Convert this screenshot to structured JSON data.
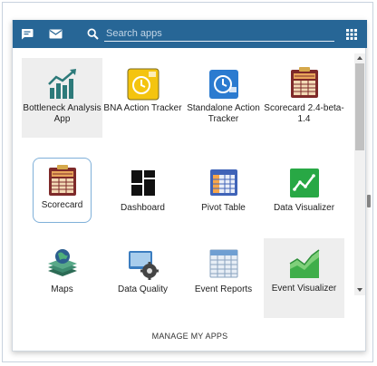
{
  "header": {
    "search": {
      "placeholder": "Search apps",
      "value": ""
    },
    "icons": {
      "messages": "chat-bubble-icon",
      "mail": "envelope-icon",
      "search": "magnifier-icon",
      "apps": "grid-icon"
    },
    "bar_color": "#276696"
  },
  "apps": [
    {
      "label": "Bottleneck Analysis App",
      "icon": "rising-bar-chart-icon",
      "state": "hover"
    },
    {
      "label": "BNA Action Tracker",
      "icon": "yellow-clock-icon",
      "state": "normal"
    },
    {
      "label": "Standalone Action Tracker",
      "icon": "blue-clock-icon",
      "state": "normal"
    },
    {
      "label": "Scorecard 2.4-beta-1.4",
      "icon": "scorecard-icon",
      "state": "normal"
    },
    {
      "label": "Scorecard",
      "icon": "scorecard-icon",
      "state": "selected"
    },
    {
      "label": "Dashboard",
      "icon": "dashboard-icon",
      "state": "normal"
    },
    {
      "label": "Pivot Table",
      "icon": "pivot-table-icon",
      "state": "normal"
    },
    {
      "label": "Data Visualizer",
      "icon": "line-chart-icon",
      "state": "normal"
    },
    {
      "label": "Maps",
      "icon": "layered-globe-icon",
      "state": "normal"
    },
    {
      "label": "Data Quality",
      "icon": "gear-monitor-icon",
      "state": "normal"
    },
    {
      "label": "Event Reports",
      "icon": "spreadsheet-icon",
      "state": "normal"
    },
    {
      "label": "Event Visualizer",
      "icon": "area-chart-icon",
      "state": "hover"
    }
  ],
  "footer": {
    "manage_label": "MANAGE MY APPS"
  },
  "colors": {
    "accent": "#276696",
    "selected_border": "#7fb0d9",
    "hover_bg": "#eeeeee"
  }
}
